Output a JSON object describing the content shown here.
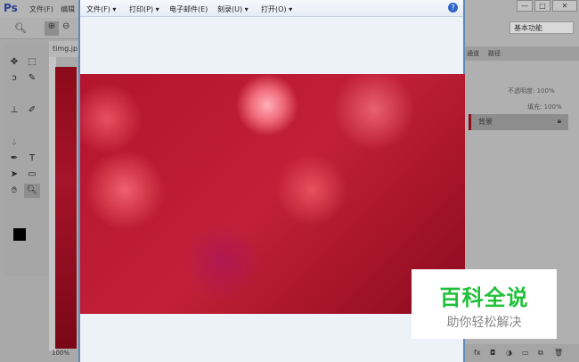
{
  "ps": {
    "logo": "Ps",
    "menu": [
      "文件(F)",
      "编辑"
    ],
    "doc_tab": "timg.jp",
    "zoom": "100%",
    "workspace": "基本功能",
    "panel_tabs": [
      "通道",
      "路径"
    ],
    "opacity_label": "不透明度: 100%",
    "fill_label": "填充: 100%",
    "layer_name": "背景",
    "window_buttons": [
      "—",
      "□",
      "✕"
    ],
    "bottom_icons": [
      "fx",
      "◘",
      "◑",
      "▭",
      "⧉",
      "🗑"
    ]
  },
  "viewer": {
    "menu": [
      "文件(F) ▾",
      "打印(P) ▾",
      "电子邮件(E)",
      "刻录(U) ▾",
      "打开(O) ▾"
    ],
    "help": "?"
  },
  "watermark": {
    "title": "百科全说",
    "subtitle": "助你轻松解决"
  }
}
